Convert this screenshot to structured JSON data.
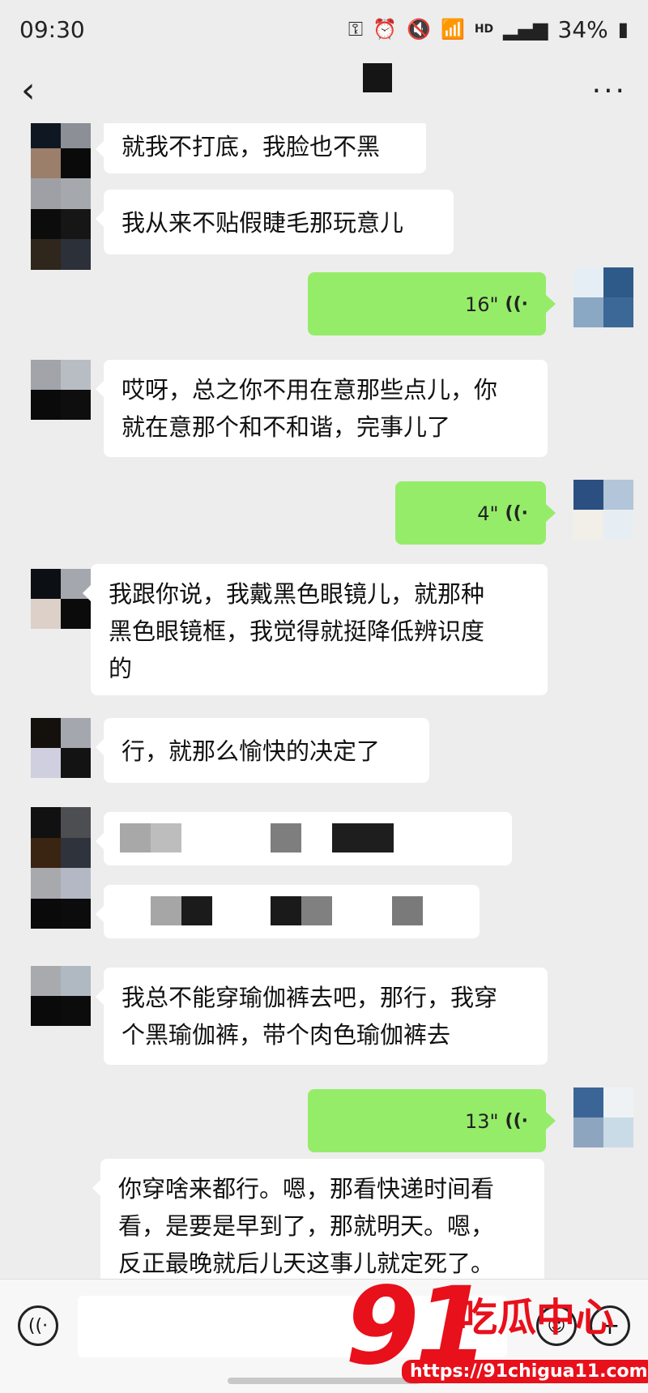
{
  "status_bar": {
    "time": "09:30",
    "hd": "HD",
    "battery": "34%",
    "icons": [
      "key-icon",
      "alarm-icon",
      "mute-icon",
      "wifi-icon",
      "signal-icon",
      "battery-icon"
    ]
  },
  "nav": {
    "back_icon": "chevron-left-icon",
    "more_icon": "more-icon"
  },
  "messages": [
    {
      "side": "left",
      "type": "text",
      "text": "就我不打底，我脸也不黑"
    },
    {
      "side": "left",
      "type": "text",
      "text": "我从来不贴假睫毛那玩意儿"
    },
    {
      "side": "right",
      "type": "voice",
      "duration": "16\""
    },
    {
      "side": "left",
      "type": "text",
      "lines": [
        "哎呀，总之你不用在意那些点儿，你",
        "就在意那个和不和谐，完事儿了"
      ]
    },
    {
      "side": "right",
      "type": "voice",
      "duration": "4\""
    },
    {
      "side": "left",
      "type": "text",
      "lines": [
        "我跟你说，我戴黑色眼镜儿，就那种",
        "黑色眼镜框，我觉得就挺降低辨识度",
        "的"
      ]
    },
    {
      "side": "left",
      "type": "text",
      "text": "行，就那么愉快的决定了"
    },
    {
      "side": "left",
      "type": "redacted"
    },
    {
      "side": "left",
      "type": "redacted"
    },
    {
      "side": "left",
      "type": "text",
      "lines": [
        "我总不能穿瑜伽裤去吧，那行，我穿",
        "个黑瑜伽裤，带个肉色瑜伽裤去"
      ]
    },
    {
      "side": "right",
      "type": "voice",
      "duration": "13\""
    },
    {
      "side": "left",
      "type": "text",
      "lines": [
        "你穿啥来都行。嗯，那看快递时间看",
        "看，是要是早到了，那就明天。嗯，",
        "反正最晚就后儿天这事儿就定死了。"
      ]
    }
  ],
  "input": {
    "voice_icon": "voice-mode-icon",
    "emoji_icon": "emoji-icon",
    "plus_icon": "plus-icon"
  },
  "watermark": {
    "number": "91",
    "text": "吃瓜中心",
    "url": "https://91chigua11.com"
  },
  "colors": {
    "background": "#ededed",
    "bubble_left": "#ffffff",
    "bubble_right": "#95ec69",
    "watermark": "#e8101b"
  }
}
